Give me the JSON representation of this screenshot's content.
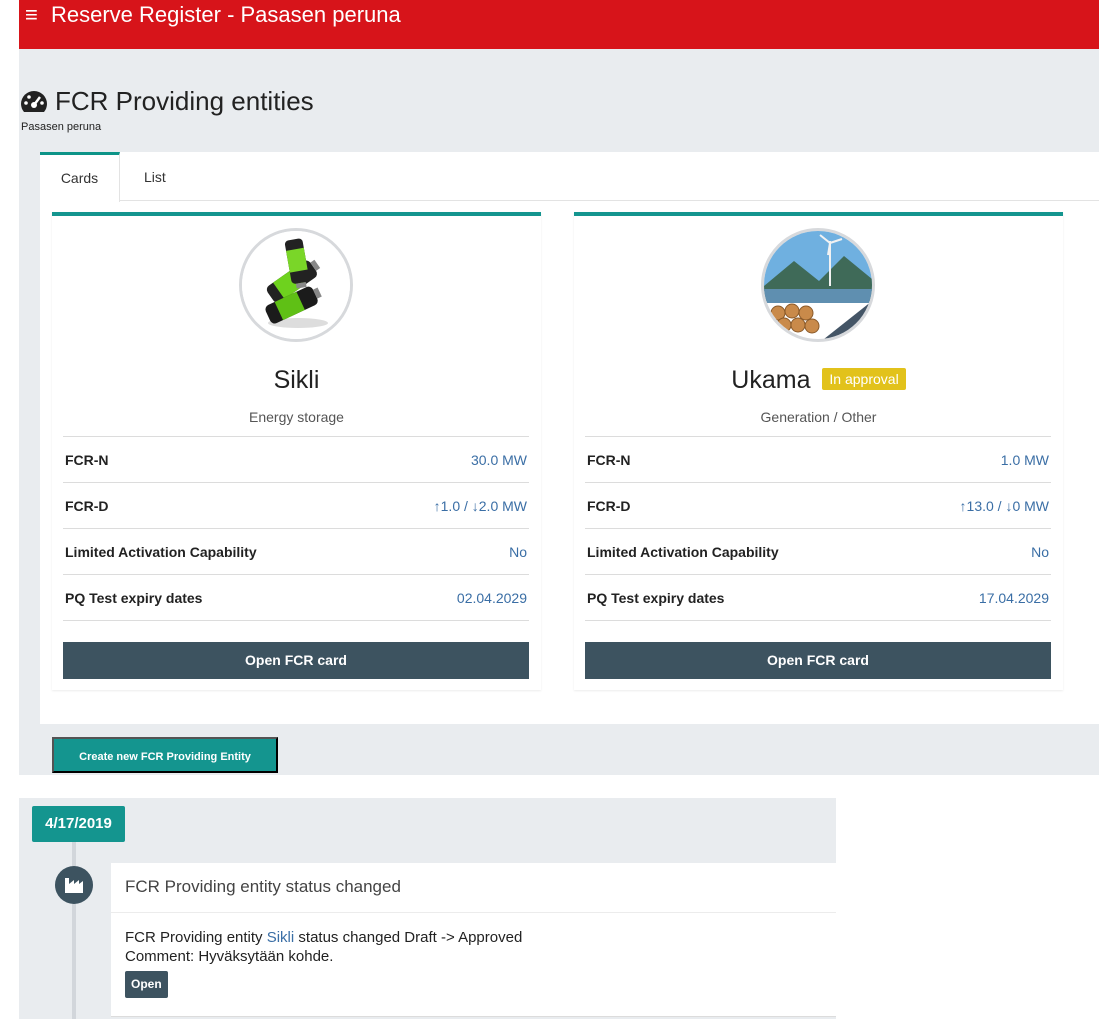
{
  "header": {
    "title": "Reserve Register - Pasasen peruna"
  },
  "page": {
    "title": "FCR Providing entities",
    "subtitle": "Pasasen peruna"
  },
  "tabs": [
    {
      "label": "Cards"
    },
    {
      "label": "List"
    }
  ],
  "cards": [
    {
      "name": "Sikli",
      "type": "Energy storage",
      "rows": [
        {
          "label": "FCR-N",
          "value": "30.0 MW"
        },
        {
          "label": "FCR-D",
          "value": "↑1.0 / ↓2.0 MW"
        },
        {
          "label": "Limited Activation Capability",
          "value": "No"
        },
        {
          "label": "PQ Test expiry dates",
          "value": "02.04.2029"
        }
      ],
      "button": "Open FCR card"
    },
    {
      "name": "Ukama",
      "badge": "In approval",
      "type": "Generation / Other",
      "rows": [
        {
          "label": "FCR-N",
          "value": "1.0 MW"
        },
        {
          "label": "FCR-D",
          "value": "↑13.0 / ↓0 MW"
        },
        {
          "label": "Limited Activation Capability",
          "value": "No"
        },
        {
          "label": "PQ Test expiry dates",
          "value": "17.04.2029"
        }
      ],
      "button": "Open FCR card"
    }
  ],
  "create_button": "Create new FCR Providing Entity",
  "timeline": {
    "date": "4/17/2019",
    "item": {
      "title": "FCR Providing entity status changed",
      "text_before": "FCR Providing entity ",
      "link": "Sikli",
      "text_after": " status changed Draft -> Approved",
      "comment": "Comment: Hyväksytään kohde.",
      "open_label": "Open"
    }
  },
  "colors": {
    "header": "#d7141a",
    "accent": "#14958f",
    "dark_button": "#3d5360",
    "badge": "#e2c21b",
    "link": "#3a6ea5"
  }
}
